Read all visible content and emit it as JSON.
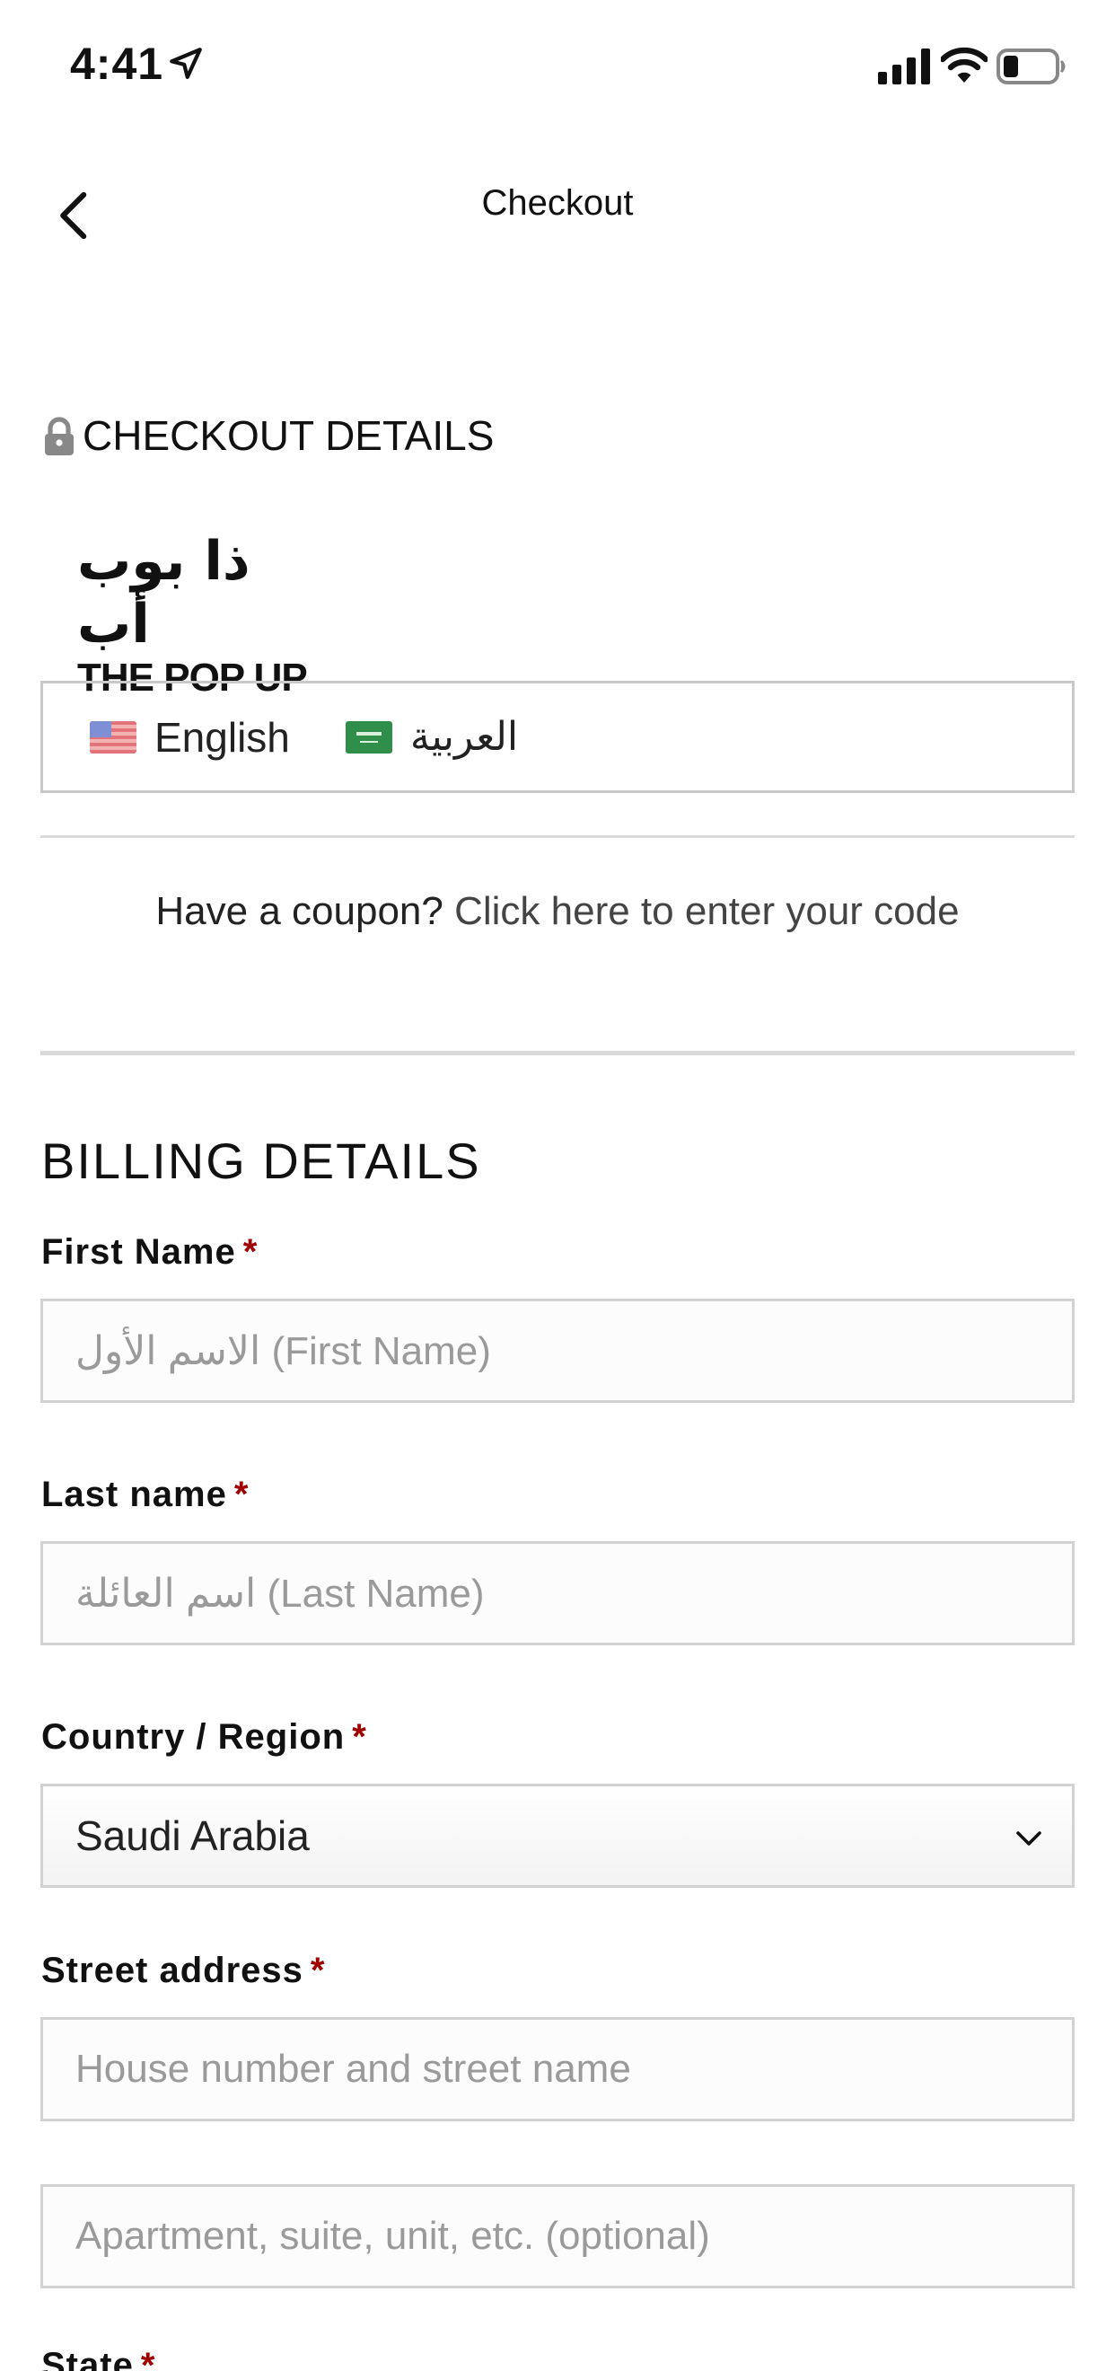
{
  "status_bar": {
    "time": "4:41"
  },
  "nav": {
    "title": "Checkout"
  },
  "checkout": {
    "heading": "CHECKOUT DETAILS"
  },
  "logo": {
    "arabic": "ذا بوب أب",
    "english": "THE POP UP"
  },
  "languages": [
    {
      "label": "English",
      "flag": "us-flag-icon"
    },
    {
      "label": "العربية",
      "flag": "sa-flag-icon"
    }
  ],
  "coupon": {
    "prompt": "Have a coupon?",
    "link": "Click here to enter your code"
  },
  "billing": {
    "title": "BILLING DETAILS",
    "required_mark": "*",
    "first_name": {
      "label": "First Name",
      "placeholder": "الاسم الأول (First Name)"
    },
    "last_name": {
      "label": "Last name",
      "placeholder": "اسم العائلة (Last Name)"
    },
    "country": {
      "label": "Country / Region",
      "value": "Saudi Arabia"
    },
    "street": {
      "label": "Street address",
      "placeholder_1": "House number and street name",
      "placeholder_2": "Apartment, suite, unit, etc. (optional)"
    },
    "state": {
      "label": "State"
    }
  },
  "colors": {
    "required": "#a00000",
    "border": "#d2d2d2",
    "placeholder": "#9a9a9a"
  }
}
